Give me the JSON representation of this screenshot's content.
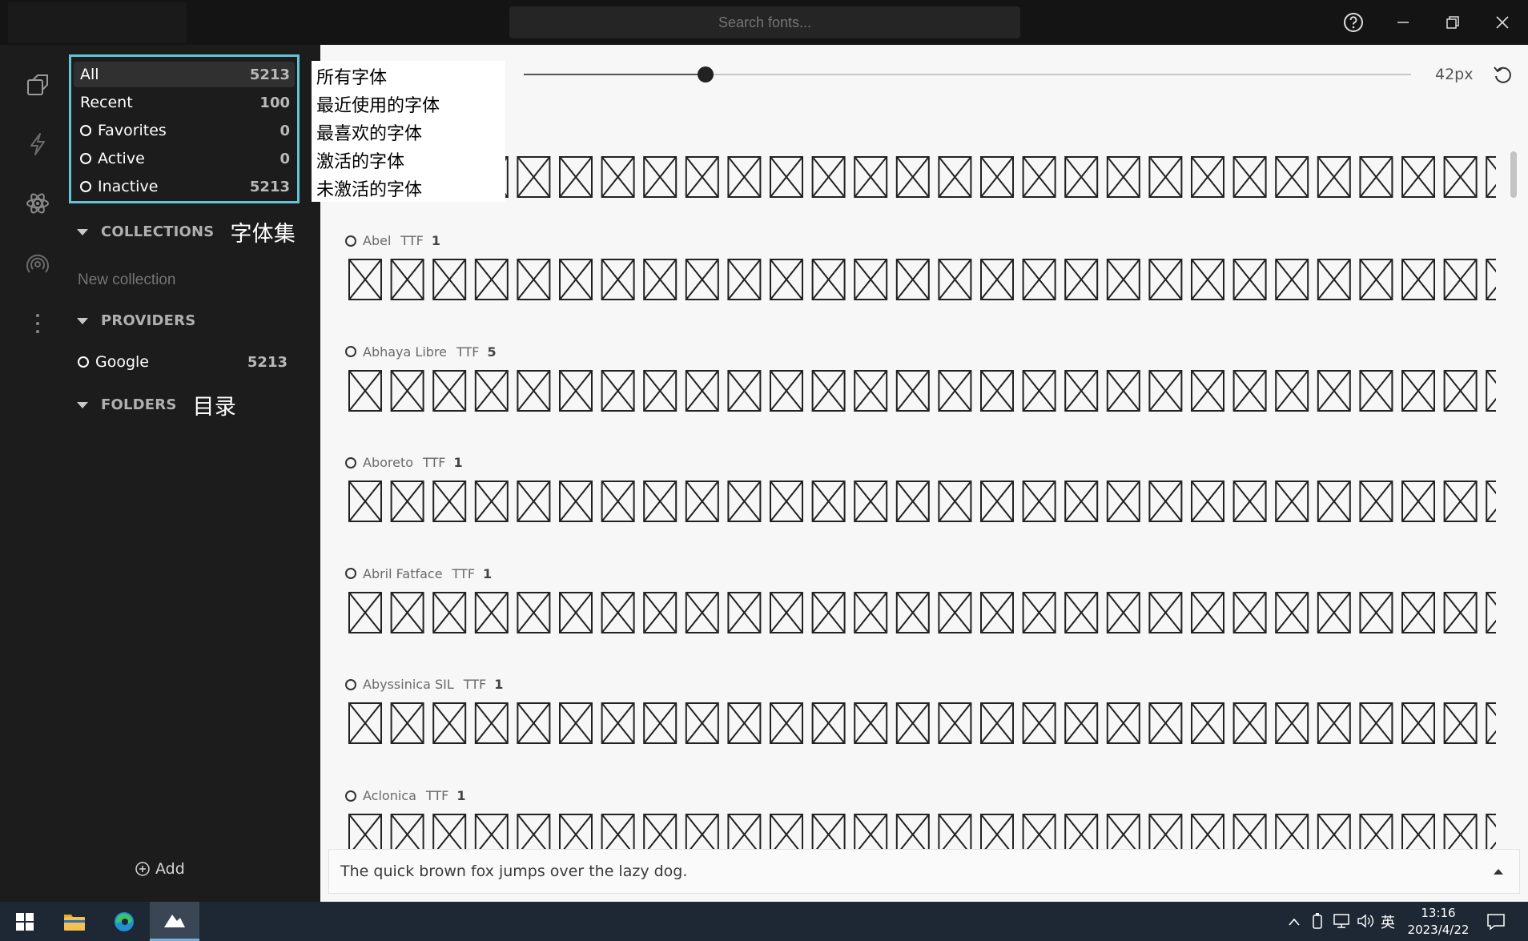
{
  "titlebar": {
    "search_placeholder": "Search fonts..."
  },
  "filters": [
    {
      "label": "All",
      "count": "5213",
      "selected": true,
      "circle": false
    },
    {
      "label": "Recent",
      "count": "100",
      "selected": false,
      "circle": false
    },
    {
      "label": "Favorites",
      "count": "0",
      "selected": false,
      "circle": true
    },
    {
      "label": "Active",
      "count": "0",
      "selected": false,
      "circle": true
    },
    {
      "label": "Inactive",
      "count": "5213",
      "selected": false,
      "circle": true
    }
  ],
  "sections": {
    "collections": "COLLECTIONS",
    "collections_cn": "字体集",
    "new_collection": "New collection",
    "providers": "PROVIDERS",
    "provider_items": [
      {
        "label": "Google",
        "count": "5213"
      }
    ],
    "folders": "FOLDERS",
    "folders_cn": "目录",
    "add_label": "Add"
  },
  "cn_overlay": [
    "所有字体",
    "最近使用的字体",
    "最喜欢的字体",
    "激活的字体",
    "未激活的字体"
  ],
  "toolbar": {
    "size_label": "42px",
    "size_fraction": 0.205
  },
  "fonts": [
    {
      "name": "Abel",
      "format": "TTF",
      "count": "1"
    },
    {
      "name": "Abhaya Libre",
      "format": "TTF",
      "count": "5"
    },
    {
      "name": "Aboreto",
      "format": "TTF",
      "count": "1"
    },
    {
      "name": "Abril Fatface",
      "format": "TTF",
      "count": "1"
    },
    {
      "name": "Abyssinica SIL",
      "format": "TTF",
      "count": "1"
    },
    {
      "name": "Aclonica",
      "format": "TTF",
      "count": "1"
    }
  ],
  "sample": {
    "text": "The quick brown fox jumps over the lazy dog."
  },
  "taskbar": {
    "ime": "英",
    "time": "13:16",
    "date": "2023/4/22"
  },
  "colors": {
    "accent": "#62c4d6",
    "taskbar": "#1d2834"
  }
}
